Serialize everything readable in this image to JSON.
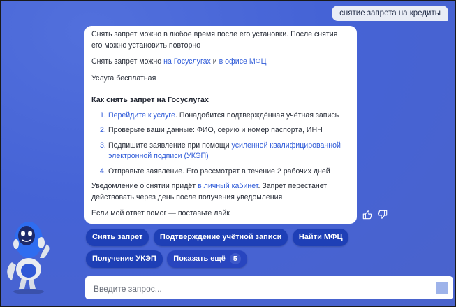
{
  "user_message": "снятие запрета на кредиты",
  "bot": {
    "p1": "Снять запрет можно в любое время после его установки. После снятия его можно установить повторно",
    "p2_before": "Снять запрет можно ",
    "p2_link1": "на Госуслугах",
    "p2_mid": " и ",
    "p2_link2": "в офисе МФЦ",
    "p3": "Услуга бесплатная",
    "heading": "Как снять запрет на Госуслугах",
    "steps": [
      {
        "num": "1.",
        "link": "Перейдите к услуге",
        "text": ". Понадобится подтверждённая учётная запись"
      },
      {
        "num": "2.",
        "text": "Проверьте ваши данные: ФИО, серию и номер паспорта, ИНН"
      },
      {
        "num": "3.",
        "before": "Подпишите заявление при помощи ",
        "link": "усиленной квалифицированной электронной подписи (УКЭП)"
      },
      {
        "num": "4.",
        "text": "Отправьте заявление. Его рассмотрят в течение 2 рабочих дней"
      }
    ],
    "p4_before": "Уведомление о снятии придёт ",
    "p4_link": "в личный кабинет",
    "p4_after": ". Запрет перестанет действовать через день после получения уведомления",
    "p5": "Если мой ответ помог — поставьте лайк"
  },
  "chips": {
    "c1": "Снять запрет",
    "c2": "Подтверждение учётной записи",
    "c3": "Найти МФЦ",
    "c4": "Получение УКЭП",
    "more": "Показать ещё",
    "more_count": "5"
  },
  "input": {
    "placeholder": "Введите запрос..."
  },
  "colors": {
    "accent": "#2f5bd8",
    "chip": "#1e3fb6",
    "background": "#4563d6"
  }
}
